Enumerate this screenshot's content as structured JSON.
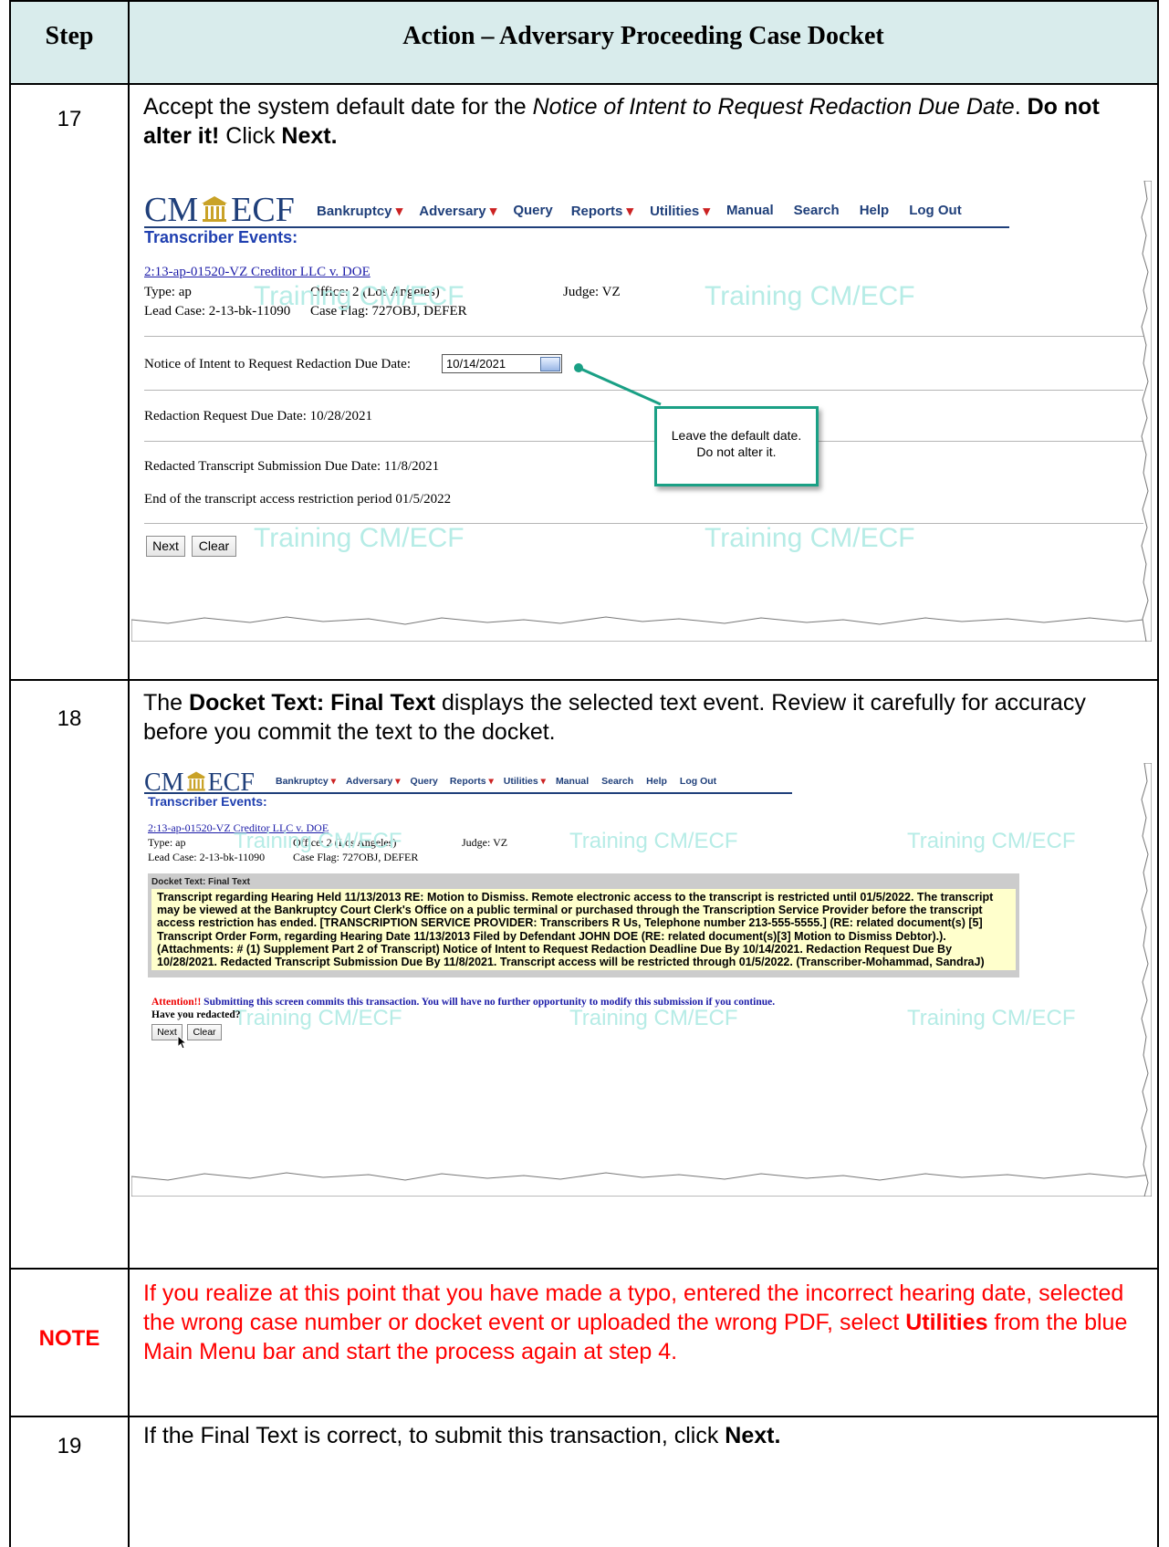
{
  "header": {
    "step": "Step",
    "action": "Action – Adversary Proceeding Case Docket"
  },
  "step17": {
    "num": "17",
    "t1": "Accept the system default date for the ",
    "t2": "Notice of Intent to Request Redaction Due Date",
    "t3": ".  ",
    "t4": "Do not alter it!",
    "t5": "  Click ",
    "t6": "Next."
  },
  "step18": {
    "num": "18",
    "t1": "The ",
    "t2": "Docket Text: Final Text",
    "t3": " displays the selected text event.  Review it carefully for accuracy before you commit the text to the docket."
  },
  "note": {
    "label": "NOTE",
    "t1": "If you realize at this point that you have made a typo, entered the incorrect hearing date, selected the wrong case number or docket event or uploaded the wrong PDF, select ",
    "t2": "Utilities",
    "t3": " from the blue Main Menu bar and start the process again at step 4."
  },
  "step19": {
    "num": "19",
    "t1": "If the Final Text is correct, to submit this transaction, click ",
    "t2": "Next."
  },
  "app": {
    "logo_left": "CM",
    "logo_right": "ECF",
    "menu": [
      "Bankruptcy",
      "Adversary",
      "Query",
      "Reports",
      "Utilities",
      "Manual",
      "Search",
      "Help",
      "Log Out"
    ],
    "dropdown_marker": "▾",
    "page_title": "Transcriber Events:",
    "case_link": "2:13-ap-01520-VZ Creditor LLC v. DOE",
    "type": "Type: ap",
    "office": "Office: 2 (Los Angeles)",
    "judge": "Judge: VZ",
    "lead_case": "Lead Case: 2-13-bk-11090",
    "case_flag": "Case Flag: 727OBJ, DEFER",
    "watermark": "Training CM/ECF",
    "next_label": "Next",
    "clear_label": "Clear"
  },
  "shot1": {
    "notice_label": "Notice of Intent to Request Redaction Due Date:",
    "notice_value": "10/14/2021",
    "redaction_req": "Redaction Request Due Date: 10/28/2021",
    "redacted_sub": "Redacted Transcript Submission Due Date: 11/8/2021",
    "end_restriction": "End of the transcript access restriction period 01/5/2022",
    "callout_line1": "Leave the default date.",
    "callout_line2": "Do not alter it."
  },
  "shot2": {
    "docket_label": "Docket Text: Final Text",
    "docket_text": "Transcript regarding Hearing Held 11/13/2013 RE: Motion to Dismiss. Remote electronic access to the transcript is restricted until 01/5/2022. The transcript may be viewed at the Bankruptcy Court Clerk's Office on a public terminal or purchased through the Transcription Service Provider before the transcript access restriction has ended. [TRANSCRIPTION SERVICE PROVIDER: Transcribers R Us, Telephone number 213-555-5555.] (RE: related document(s) [5] Transcript Order Form, regarding Hearing Date 11/13/2013 Filed by Defendant JOHN DOE (RE: related document(s)[3] Motion to Dismiss Debtor).). (Attachments: # (1) Supplement Part 2 of Transcript) Notice of Intent to Request Redaction Deadline Due By 10/14/2021. Redaction Request Due By 10/28/2021. Redacted Transcript Submission Due By 11/8/2021. Transcript access will be restricted through 01/5/2022. (Transcriber-Mohammad, SandraJ)",
    "attention": "Attention!!",
    "attention_rest": " Submitting this screen commits this transaction. You will have no further opportunity to modify this submission if you continue.",
    "have_redacted": "Have you redacted?"
  }
}
